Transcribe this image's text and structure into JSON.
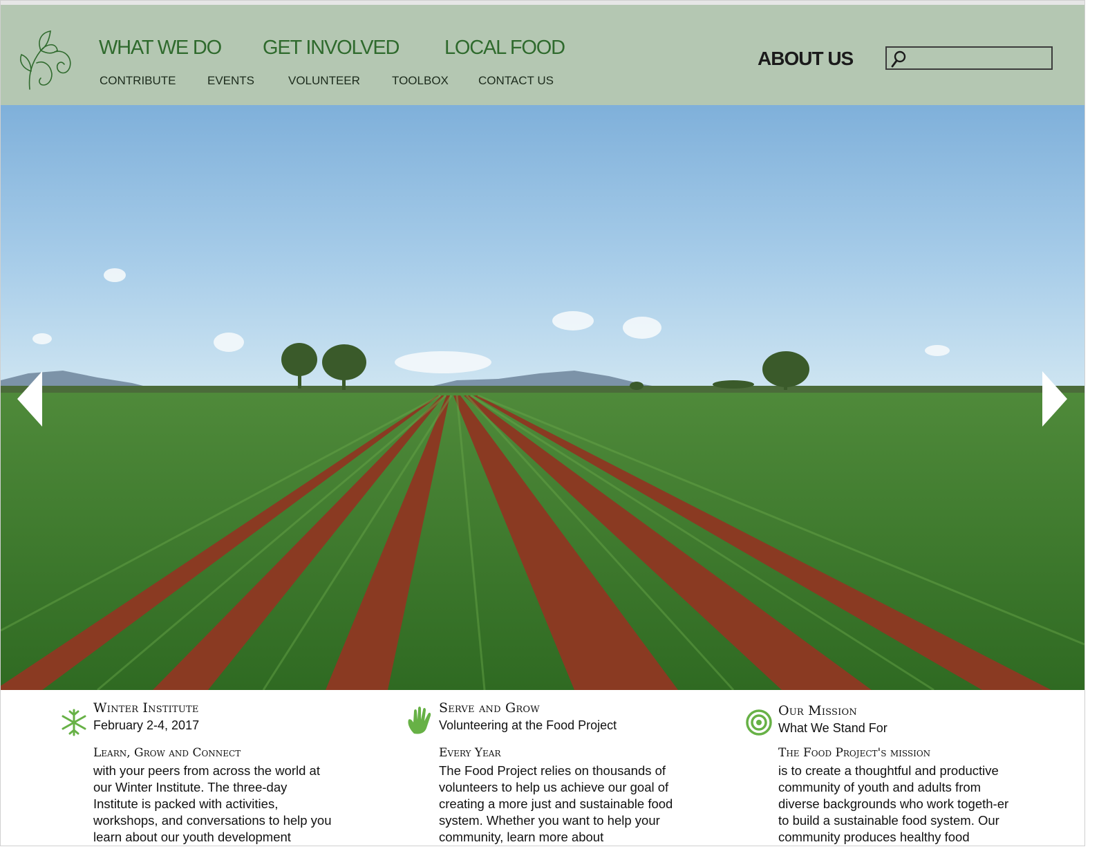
{
  "colors": {
    "header_bg": "#b4c7b2",
    "primary_nav": "#2f6a2d",
    "icon_green": "#67b146"
  },
  "nav": {
    "primary": [
      "WHAT WE DO",
      "GET INVOLVED",
      "LOCAL FOOD"
    ],
    "secondary": [
      "CONTRIBUTE",
      "EVENTS",
      "VOLUNTEER",
      "TOOLBOX",
      "CONTACT US"
    ],
    "about": "ABOUT US"
  },
  "search": {
    "value": "",
    "placeholder": ""
  },
  "hero": {
    "prev_icon": "chevron-left-icon",
    "next_icon": "chevron-right-icon"
  },
  "columns": [
    {
      "icon": "snowflake-icon",
      "title": "Winter Institute",
      "subtitle": "February 2-4, 2017",
      "heading": "Learn, Grow and Connect",
      "body": "with your peers from across the world at our Winter Institute. The three-day Institute is packed with activities, workshops, and conversations to help you learn about our youth development"
    },
    {
      "icon": "hand-icon",
      "title": "Serve and Grow",
      "subtitle": "Volunteering at the Food Project",
      "heading": "Every Year",
      "body": "The Food Project relies on thousands of volunteers to help us achieve our goal of creating a more just and sustainable food system. Whether you want to help your community, learn more about"
    },
    {
      "icon": "target-icon",
      "title": "Our Mission",
      "subtitle": "What We Stand For",
      "heading": "The Food Project's mission",
      "body": "is to create a thoughtful and productive community of youth and adults from diverse backgrounds who work togeth-er to build a sustainable food system. Our community produces healthy food"
    }
  ]
}
